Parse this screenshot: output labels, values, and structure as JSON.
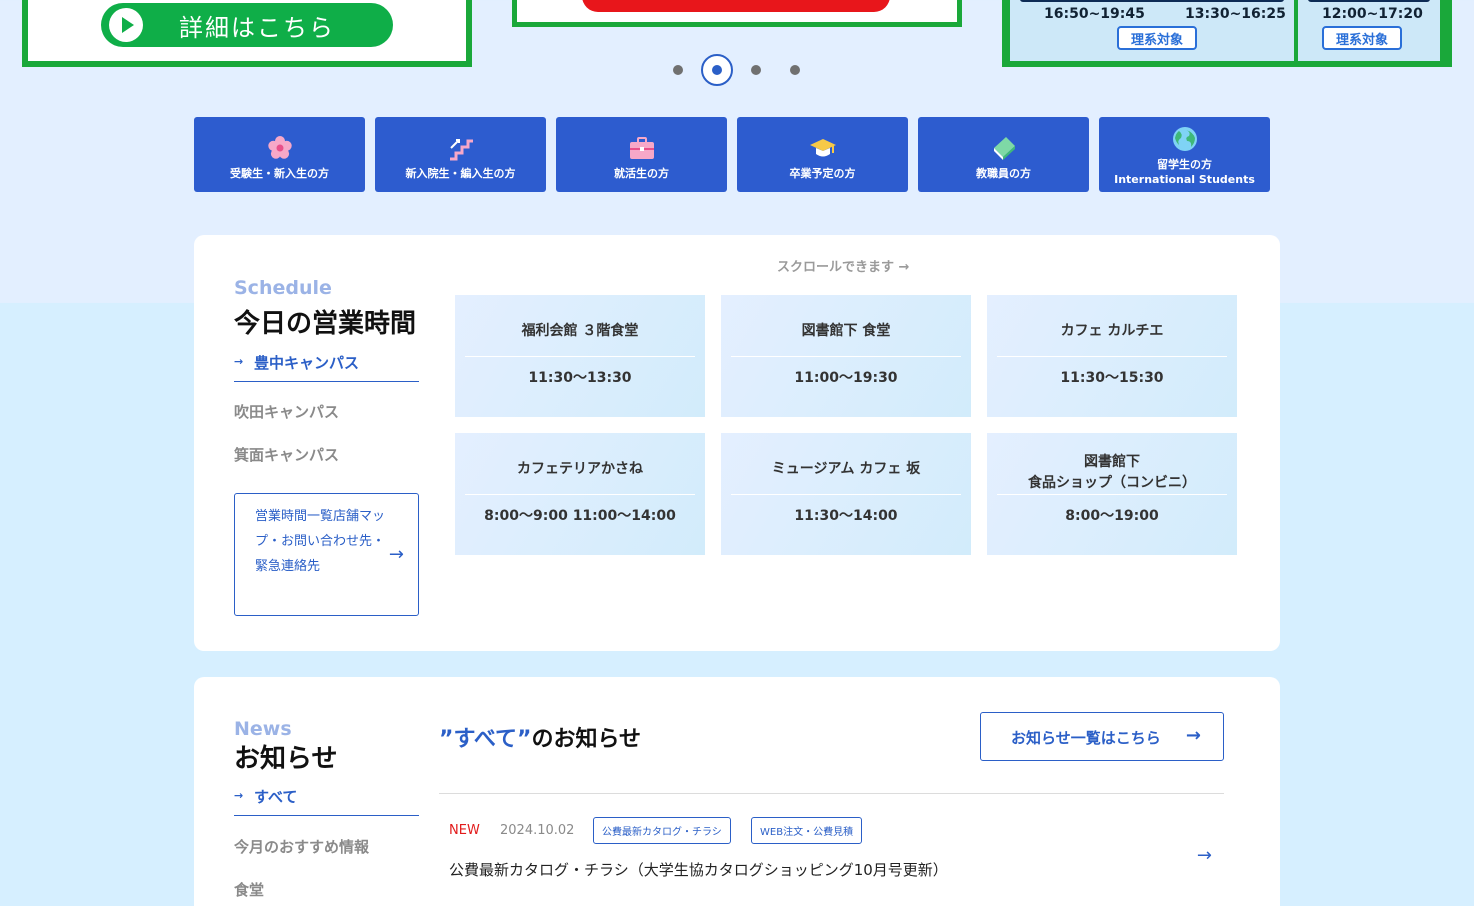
{
  "banners": {
    "left": {
      "button_label": "詳細はこちら"
    },
    "right": {
      "panel1_times": [
        "16:50~19:45",
        "13:30~16:25"
      ],
      "panel2_time": "12:00~17:20",
      "tag_label": "理系対象"
    },
    "carousel_active_index": 1,
    "carousel_count": 4
  },
  "audience_nav": [
    {
      "label": "受験生・新入生の方",
      "icon": "sakura-icon"
    },
    {
      "label": "新入院生・編入生の方",
      "icon": "stairs-icon"
    },
    {
      "label": "就活生の方",
      "icon": "briefcase-icon"
    },
    {
      "label": "卒業予定の方",
      "icon": "graduation-cap-icon"
    },
    {
      "label": "教職員の方",
      "icon": "book-icon"
    },
    {
      "label": "留学生の方",
      "label2": "International Students",
      "icon": "globe-icon"
    }
  ],
  "schedule": {
    "section_en": "Schedule",
    "section_jp": "今日の営業時間",
    "campuses": [
      "豊中キャンパス",
      "吹田キャンパス",
      "箕面キャンパス"
    ],
    "active_campus": "豊中キャンパス",
    "hours_link_label": "営業時間一覧店舗マップ・お問い合わせ先・緊急連絡先",
    "scroll_hint": "スクロールできます →",
    "shops": [
      {
        "name": "福利会館 ３階食堂",
        "hours": "11:30〜13:30"
      },
      {
        "name": "図書館下 食堂",
        "hours": "11:00〜19:30"
      },
      {
        "name": "カフェ カルチエ",
        "hours": "11:30〜15:30"
      },
      {
        "name": "カフェテリアかさね",
        "hours": "8:00〜9:00 11:00〜14:00"
      },
      {
        "name": "ミュージアム カフェ 坂",
        "hours": "11:30〜14:00"
      },
      {
        "name": "図書館下\n食品ショップ（コンビニ）",
        "hours": "8:00〜19:00"
      }
    ]
  },
  "news": {
    "section_en": "News",
    "section_jp": "お知らせ",
    "categories": [
      "すべて",
      "今月のおすすめ情報",
      "食堂"
    ],
    "active_category": "すべて",
    "heading_quote": "”すべて”",
    "heading_suffix": "のお知らせ",
    "more_label": "お知らせ一覧はこちら",
    "items": [
      {
        "badge": "NEW",
        "date": "2024.10.02",
        "tags": [
          "公費最新カタログ・チラシ",
          "WEB注文・公費見積"
        ],
        "title": "公費最新カタログ・チラシ（大学生協カタログショッピング10月号更新）"
      }
    ]
  },
  "colors": {
    "primary_blue": "#2d5ccf",
    "link_blue": "#2b5fc7",
    "banner_green": "#1aa83a",
    "new_red": "#e21b1b"
  }
}
